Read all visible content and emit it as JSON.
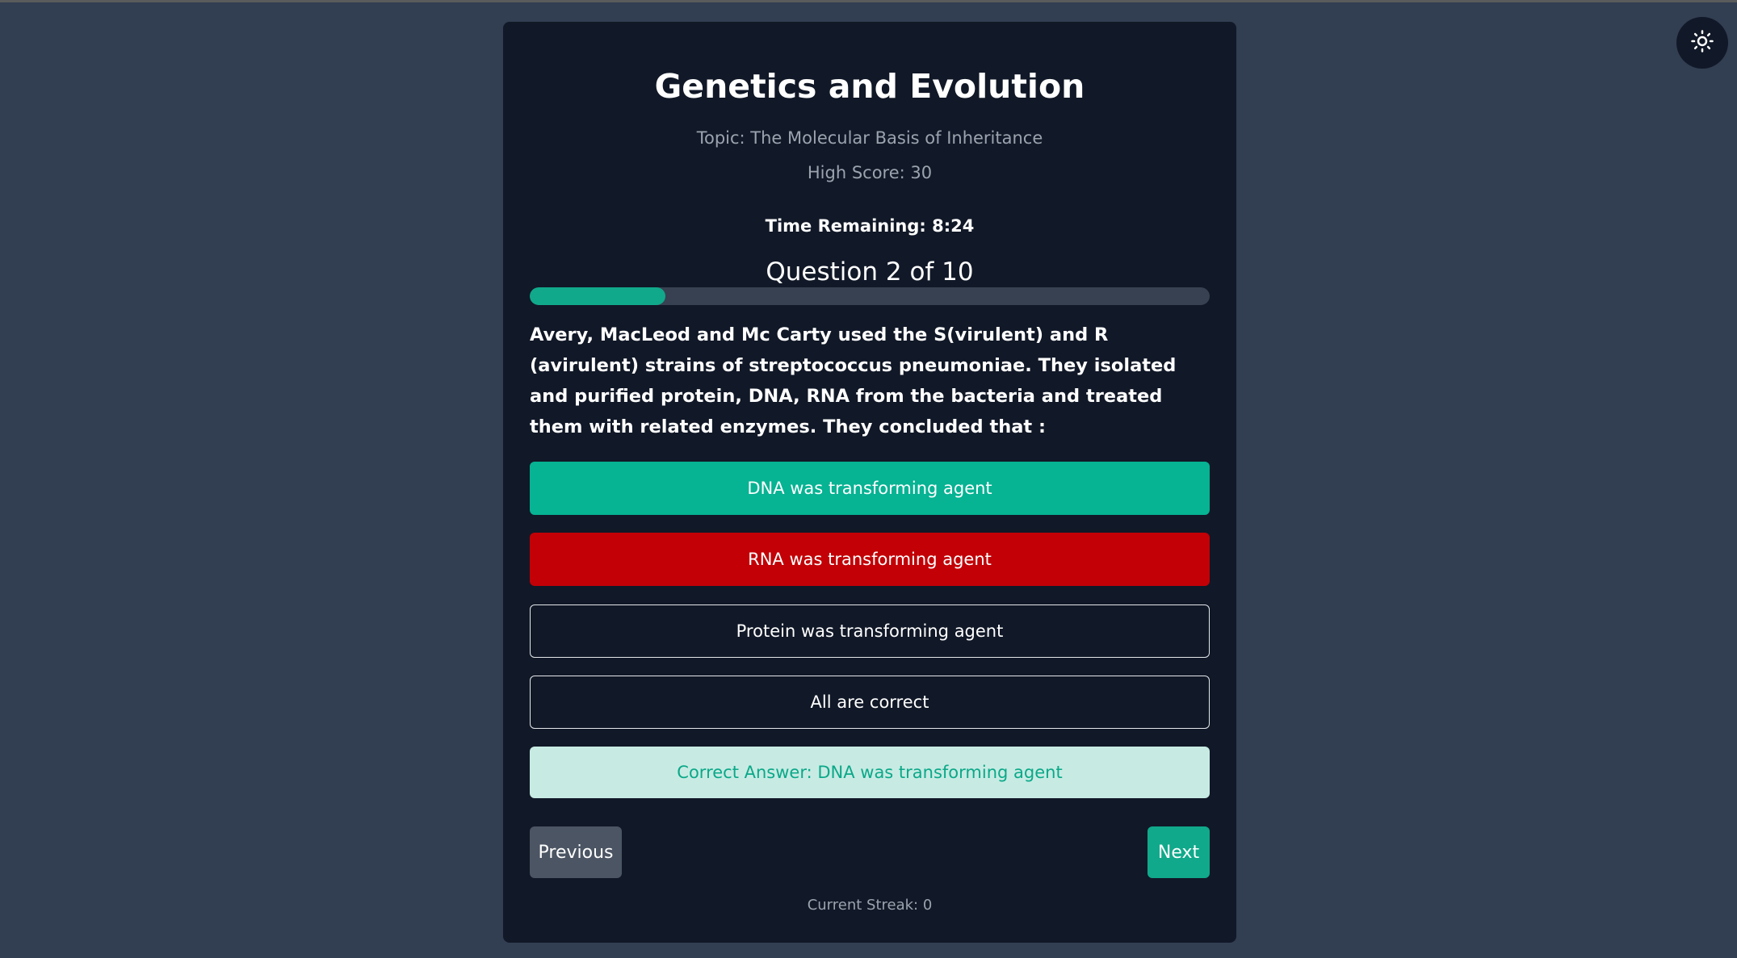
{
  "quiz": {
    "title": "Genetics and Evolution",
    "topic": "Topic: The Molecular Basis of Inheritance",
    "high_score": "High Score: 30",
    "timer": "Time Remaining: 8:24",
    "question_number": "Question 2 of 10",
    "progress": 0.2,
    "question_text": "Avery, MacLeod and Mc Carty used the S(virulent) and R (avirulent) strains of streptococcus pneumoniae. They isolated and purified protein, DNA, RNA from the bacteria and treated them with related enzymes. They concluded that :",
    "options": [
      {
        "label": "DNA was transforming agent",
        "state": "correct"
      },
      {
        "label": "RNA was transforming agent",
        "state": "wrong"
      },
      {
        "label": "Protein was transforming agent",
        "state": "default"
      },
      {
        "label": "All are correct",
        "state": "default"
      }
    ],
    "correct_answer": "Correct Answer: DNA was transforming agent",
    "prev_label": "Previous",
    "next_label": "Next",
    "streak": "Current Streak: 0"
  },
  "theme_toggle": {
    "icon": "sun-icon"
  },
  "colors": {
    "background": "#323e52",
    "card": "#111827",
    "accent": "#10a98b",
    "correct": "#06b393",
    "wrong": "#c20006",
    "answer_bg": "#c7ebe3"
  }
}
